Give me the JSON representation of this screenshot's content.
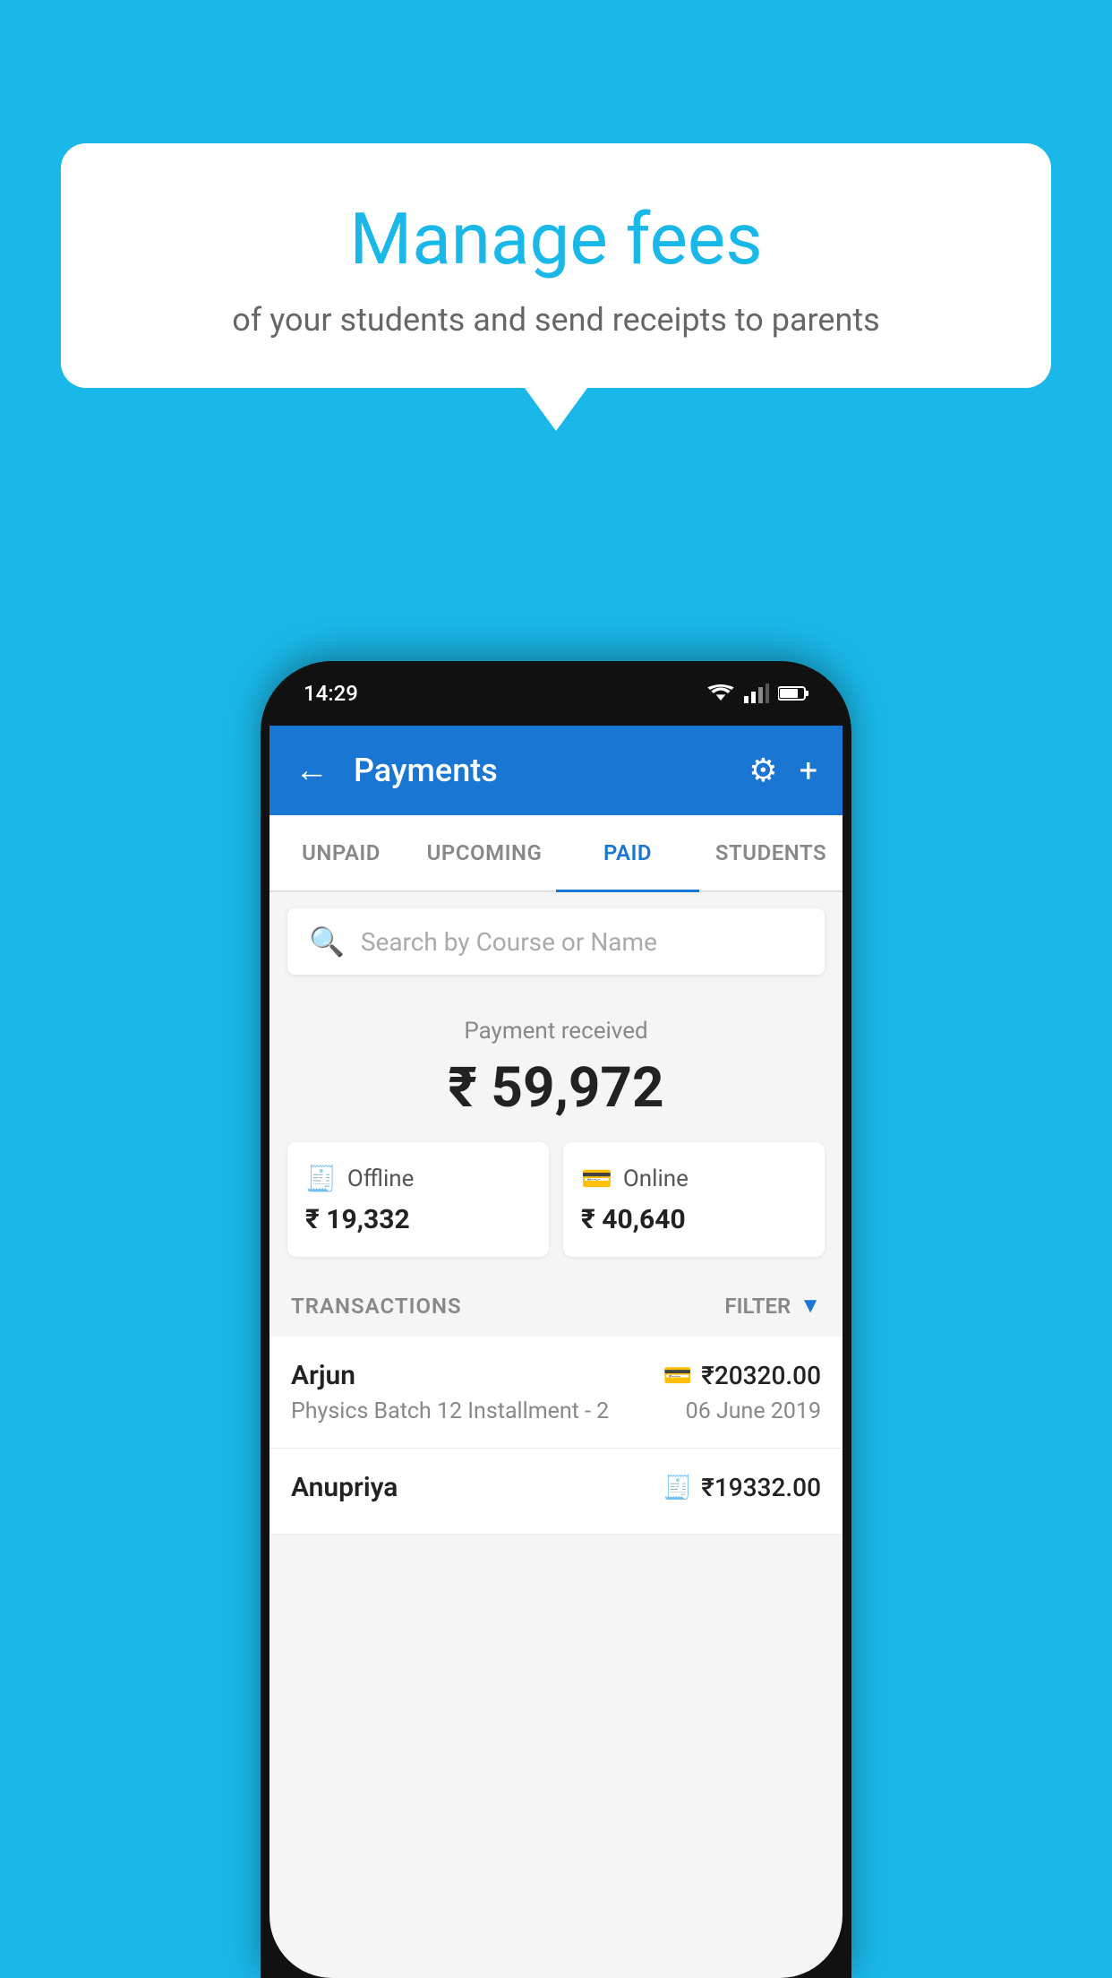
{
  "background_color": "#1ab8e8",
  "speech_bubble": {
    "title": "Manage fees",
    "subtitle": "of your students and send receipts to parents"
  },
  "phone": {
    "status_bar": {
      "time": "14:29"
    },
    "app_bar": {
      "title": "Payments",
      "back_label": "←",
      "settings_icon": "⚙",
      "add_icon": "+"
    },
    "tabs": [
      {
        "label": "UNPAID",
        "active": false
      },
      {
        "label": "UPCOMING",
        "active": false
      },
      {
        "label": "PAID",
        "active": true
      },
      {
        "label": "STUDENTS",
        "active": false
      }
    ],
    "search": {
      "placeholder": "Search by Course or Name"
    },
    "payment_summary": {
      "label": "Payment received",
      "total": "₹ 59,972",
      "offline_label": "Offline",
      "offline_amount": "₹ 19,332",
      "online_label": "Online",
      "online_amount": "₹ 40,640"
    },
    "transactions": {
      "header_label": "TRANSACTIONS",
      "filter_label": "FILTER",
      "items": [
        {
          "name": "Arjun",
          "course": "Physics Batch 12 Installment - 2",
          "amount": "₹20320.00",
          "date": "06 June 2019",
          "type_icon": "💳"
        },
        {
          "name": "Anupriya",
          "course": "",
          "amount": "₹19332.00",
          "date": "",
          "type_icon": "🧾"
        }
      ]
    }
  }
}
